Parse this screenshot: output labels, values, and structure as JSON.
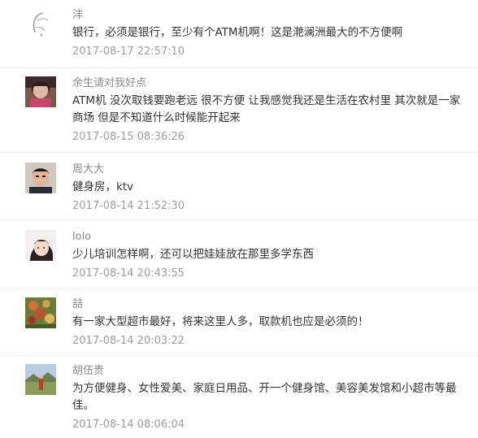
{
  "comments": [
    {
      "name": "沣",
      "text": "银行，必须是银行，至少有个ATM机啊！这是滟澜洲最大的不方便啊",
      "time": "2017-08-17 22:57:10",
      "avatar": "leaf-sketch-avatar"
    },
    {
      "name": "余生请对我好点",
      "text": "ATM机 没次取钱要跑老远 很不方便 让我感觉我还是生活在农村里 其次就是一家商场 但是不知道什么时候能开起来",
      "time": "2017-08-15 08:36:26",
      "avatar": "person-photo-avatar"
    },
    {
      "name": "周大大",
      "text": "健身房，ktv",
      "time": "2017-08-14 21:52:30",
      "avatar": "man-selfie-avatar"
    },
    {
      "name": "lolo",
      "text": "少儿培训怎样啊，还可以把娃娃放在那里多学东西",
      "time": "2017-08-14 20:43:55",
      "avatar": "girl-photo-avatar"
    },
    {
      "name": "喆",
      "text": "有一家大型超市最好，将来这里人多，取款机也应是必须的！",
      "time": "2017-08-14 20:03:22",
      "avatar": "flower-photo-avatar"
    },
    {
      "name": "胡伍贵",
      "text": "为方便健身、女性爱美、家庭日用品、开一个健身馆、美容美发馆和小超市等最佳。",
      "time": "2017-08-14 08:06:04",
      "avatar": "landscape-photo-avatar"
    }
  ]
}
